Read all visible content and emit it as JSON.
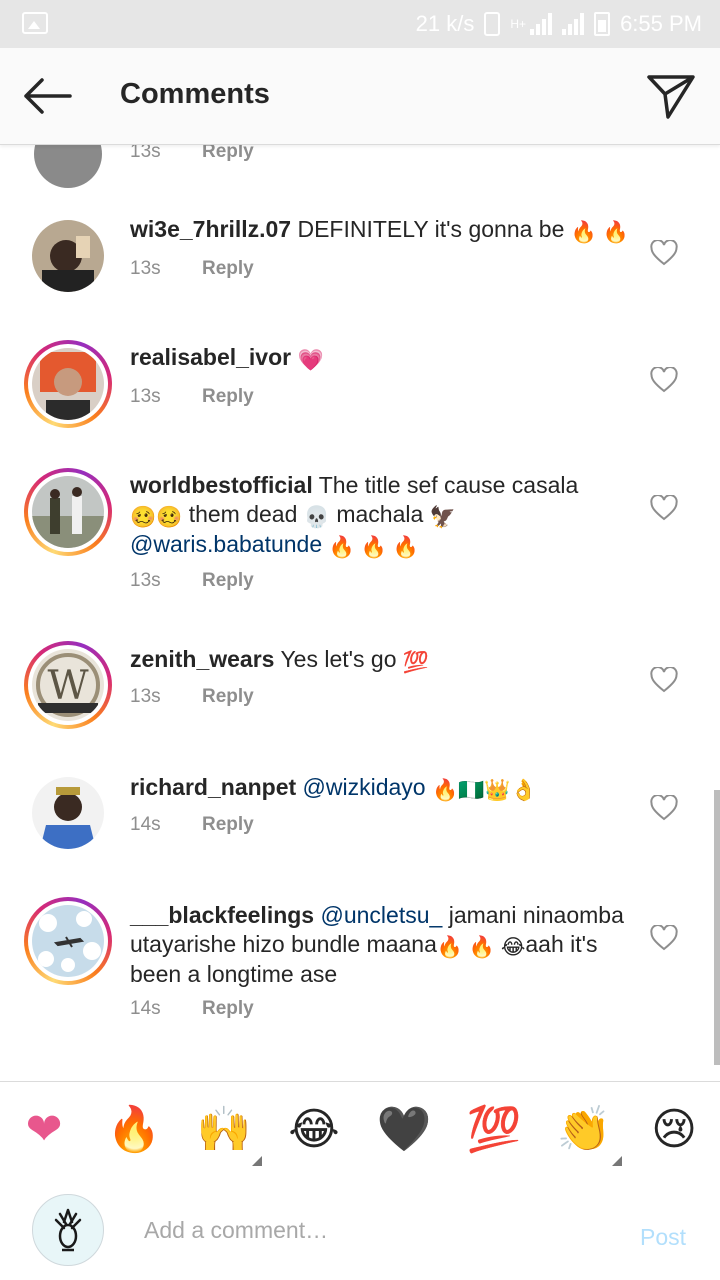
{
  "status_bar": {
    "speed": "21 k/s",
    "network": "H+",
    "time": "6:55 PM"
  },
  "header": {
    "title": "Comments"
  },
  "partial_comment": {
    "time": "13s",
    "reply_label": "Reply"
  },
  "comments": [
    {
      "username": "wi3e_7hrillz.07",
      "text": "DEFINITELY it's gonna be",
      "emojis": "🔥 🔥",
      "time": "13s",
      "reply_label": "Reply"
    },
    {
      "username": "realisabel_ivor",
      "text": "",
      "emojis": "💗",
      "time": "13s",
      "reply_label": "Reply"
    },
    {
      "username": "worldbestofficial",
      "text_1": "The title sef cause casala",
      "emojis_1": "🥴🥴",
      "text_2": "them dead",
      "emojis_2": "💀",
      "text_3": "machala",
      "emojis_3": "🦅",
      "mention": "@waris.babatunde",
      "emojis_4": "🔥 🔥 🔥",
      "time": "13s",
      "reply_label": "Reply"
    },
    {
      "username": "zenith_wears",
      "text": "Yes let's go",
      "emojis": "💯",
      "time": "13s",
      "reply_label": "Reply"
    },
    {
      "username": "richard_nanpet",
      "mention": "@wizkidayo",
      "emojis": "🔥🇳🇬👑👌",
      "time": "14s",
      "reply_label": "Reply"
    },
    {
      "username": "___blackfeelings",
      "mention": "@uncletsu_",
      "text_1": "jamani ninaomba utayarishe hizo bundle maana",
      "emojis_1": "🔥 🔥 😂",
      "text_2": "aah it's been a longtime ase",
      "time": "14s",
      "reply_label": "Reply"
    }
  ],
  "emoji_bar": [
    "❤",
    "🔥",
    "🙌",
    "😂",
    "🖤",
    "💯",
    "👏",
    "😢"
  ],
  "composer": {
    "placeholder": "Add a comment…",
    "post_label": "Post"
  },
  "colors": {
    "accent_link": "#003569",
    "post_disabled": "#b2dffc",
    "meta": "#8e8e8e"
  }
}
